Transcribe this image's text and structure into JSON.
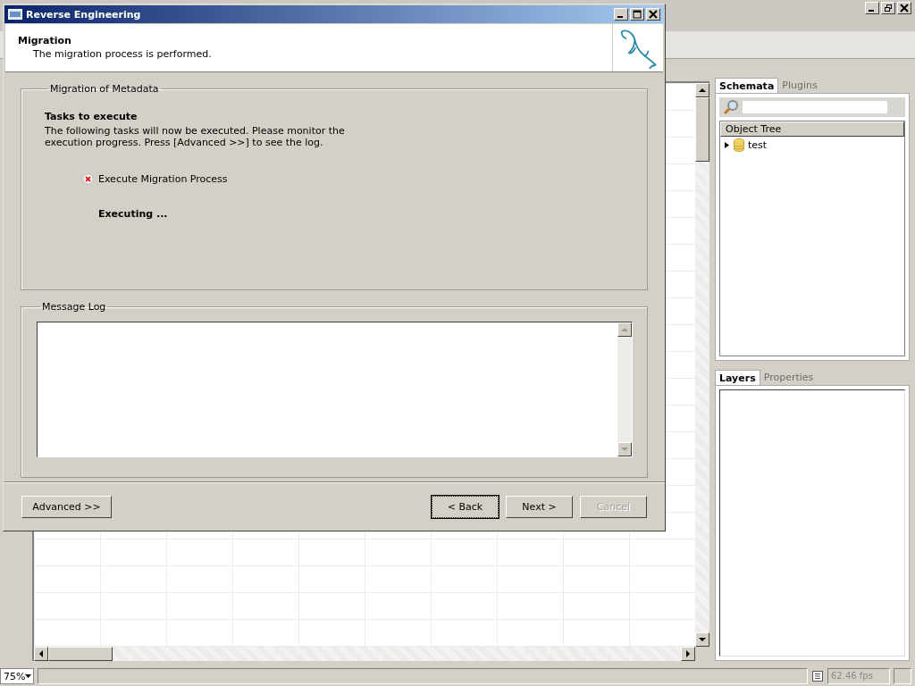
{
  "dialog": {
    "title": "Reverse Engineering",
    "header": {
      "title": "Migration",
      "subtitle": "The migration process is performed."
    },
    "metadata_group": {
      "legend": "Migration of Metadata",
      "heading": "Tasks to execute",
      "description": "The following tasks will now be executed. Please monitor the execution progress. Press [Advanced >>] to see the log.",
      "tasks": [
        {
          "label": "Execute Migration Process",
          "failed": true
        }
      ],
      "status_text": "Executing ..."
    },
    "log_group": {
      "legend": "Message Log"
    },
    "buttons_left": [
      {
        "label": "Advanced >>",
        "focused": false,
        "disabled": false
      }
    ],
    "buttons_right": [
      {
        "label": "< Back",
        "focused": true,
        "disabled": false
      },
      {
        "label": "Next >",
        "focused": false,
        "disabled": false
      },
      {
        "label": "Cancel",
        "focused": false,
        "disabled": true
      }
    ]
  },
  "schemata_panel": {
    "tabs": [
      {
        "label": "Schemata",
        "selected": true
      },
      {
        "label": "Plugins",
        "selected": false
      }
    ],
    "tree_header": "Object Tree",
    "tree": [
      {
        "label": "test",
        "expanded": false
      }
    ]
  },
  "layers_panel": {
    "tabs": [
      {
        "label": "Layers",
        "selected": true
      },
      {
        "label": "Properties",
        "selected": false
      }
    ]
  },
  "status_bar": {
    "zoom": "75%",
    "fps": "62.46 fps"
  }
}
